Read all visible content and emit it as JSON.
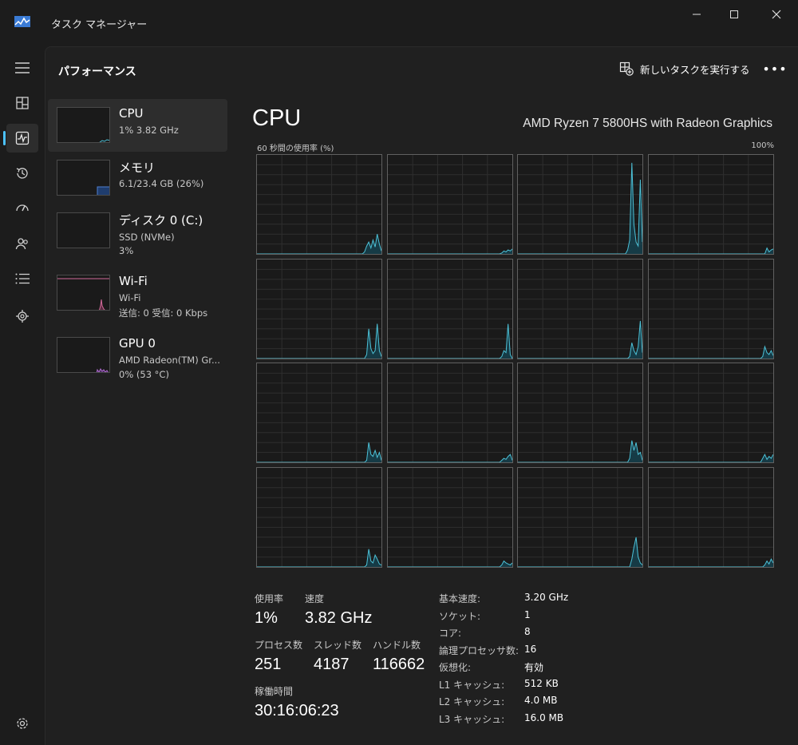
{
  "window": {
    "title": "タスク マネージャー"
  },
  "header": {
    "page_title": "パフォーマンス",
    "new_task_label": "新しいタスクを実行する",
    "more_label": "•••"
  },
  "nav": {
    "items": [
      {
        "name": "hamburger-icon"
      },
      {
        "name": "processes-icon"
      },
      {
        "name": "performance-icon",
        "active": true
      },
      {
        "name": "app-history-icon"
      },
      {
        "name": "startup-icon"
      },
      {
        "name": "users-icon"
      },
      {
        "name": "details-icon"
      },
      {
        "name": "services-icon"
      }
    ],
    "settings": "gear-icon"
  },
  "sidebar": {
    "items": [
      {
        "name": "CPU",
        "sub1": "1% 3.82 GHz",
        "sub2": "",
        "sub3": "",
        "color": "#4cc2d8"
      },
      {
        "name": "メモリ",
        "sub1": "6.1/23.4 GB (26%)",
        "sub2": "",
        "sub3": "",
        "color": "#4f7fd0",
        "level": 26
      },
      {
        "name": "ディスク 0 (C:)",
        "sub1": "SSD (NVMe)",
        "sub2": "3%",
        "sub3": "",
        "color": "#5fb85f"
      },
      {
        "name": "Wi-Fi",
        "sub1": "Wi-Fi",
        "sub2": "送信: 0 受信: 0 Kbps",
        "sub3": "",
        "color": "#d36a9a"
      },
      {
        "name": "GPU 0",
        "sub1": "AMD Radeon(TM) Gr...",
        "sub2": "0% (53 °C)",
        "sub3": "",
        "color": "#b06cd0"
      }
    ]
  },
  "main": {
    "title": "CPU",
    "model": "AMD Ryzen 7 5800HS with Radeon Graphics",
    "graph_label": "60 秒間の使用率 (%)",
    "graph_max": "100%",
    "line_color": "#4cc2d8"
  },
  "chart_data": {
    "type": "area",
    "title": "",
    "x_range": [
      0,
      60
    ],
    "ylim": [
      0,
      100
    ],
    "series": [
      {
        "values": [
          0,
          0,
          0,
          0,
          0,
          0,
          0,
          0,
          0,
          0,
          0,
          0,
          0,
          0,
          0,
          0,
          0,
          0,
          0,
          0,
          0,
          0,
          0,
          0,
          0,
          0,
          0,
          0,
          0,
          0,
          0,
          0,
          0,
          0,
          0,
          0,
          0,
          0,
          0,
          0,
          0,
          0,
          0,
          0,
          0,
          0,
          0,
          0,
          0,
          0,
          0,
          2,
          8,
          12,
          6,
          14,
          7,
          20,
          10,
          3
        ]
      },
      {
        "values": [
          0,
          0,
          0,
          0,
          0,
          0,
          0,
          0,
          0,
          0,
          0,
          0,
          0,
          0,
          0,
          0,
          0,
          0,
          0,
          0,
          0,
          0,
          0,
          0,
          0,
          0,
          0,
          0,
          0,
          0,
          0,
          0,
          0,
          0,
          0,
          0,
          0,
          0,
          0,
          0,
          0,
          0,
          0,
          0,
          0,
          0,
          0,
          0,
          0,
          0,
          0,
          0,
          0,
          0,
          1,
          3,
          2,
          4,
          3,
          5
        ]
      },
      {
        "values": [
          0,
          0,
          0,
          0,
          0,
          0,
          0,
          0,
          0,
          0,
          0,
          0,
          0,
          0,
          0,
          0,
          0,
          0,
          0,
          0,
          0,
          0,
          0,
          0,
          0,
          0,
          0,
          0,
          0,
          0,
          0,
          0,
          0,
          0,
          0,
          0,
          0,
          0,
          0,
          0,
          0,
          0,
          0,
          0,
          0,
          0,
          0,
          0,
          0,
          0,
          0,
          0,
          4,
          14,
          92,
          30,
          12,
          8,
          75,
          12
        ]
      },
      {
        "values": [
          0,
          0,
          0,
          0,
          0,
          0,
          0,
          0,
          0,
          0,
          0,
          0,
          0,
          0,
          0,
          0,
          0,
          0,
          0,
          0,
          0,
          0,
          0,
          0,
          0,
          0,
          0,
          0,
          0,
          0,
          0,
          0,
          0,
          0,
          0,
          0,
          0,
          0,
          0,
          0,
          0,
          0,
          0,
          0,
          0,
          0,
          0,
          0,
          0,
          0,
          0,
          0,
          0,
          0,
          0,
          0,
          6,
          2,
          4,
          5
        ]
      },
      {
        "values": [
          0,
          0,
          0,
          0,
          0,
          0,
          0,
          0,
          0,
          0,
          0,
          0,
          0,
          0,
          0,
          0,
          0,
          0,
          0,
          0,
          0,
          0,
          0,
          0,
          0,
          0,
          0,
          0,
          0,
          0,
          0,
          0,
          0,
          0,
          0,
          0,
          0,
          0,
          0,
          0,
          0,
          0,
          0,
          0,
          0,
          0,
          0,
          0,
          0,
          0,
          0,
          0,
          4,
          30,
          10,
          5,
          8,
          35,
          8,
          2
        ]
      },
      {
        "values": [
          0,
          0,
          0,
          0,
          0,
          0,
          0,
          0,
          0,
          0,
          0,
          0,
          0,
          0,
          0,
          0,
          0,
          0,
          0,
          0,
          0,
          0,
          0,
          0,
          0,
          0,
          0,
          0,
          0,
          0,
          0,
          0,
          0,
          0,
          0,
          0,
          0,
          0,
          0,
          0,
          0,
          0,
          0,
          0,
          0,
          0,
          0,
          0,
          0,
          0,
          0,
          0,
          0,
          0,
          2,
          8,
          6,
          35,
          4,
          0
        ]
      },
      {
        "values": [
          0,
          0,
          0,
          0,
          0,
          0,
          0,
          0,
          0,
          0,
          0,
          0,
          0,
          0,
          0,
          0,
          0,
          0,
          0,
          0,
          0,
          0,
          0,
          0,
          0,
          0,
          0,
          0,
          0,
          0,
          0,
          0,
          0,
          0,
          0,
          0,
          0,
          0,
          0,
          0,
          0,
          0,
          0,
          0,
          0,
          0,
          0,
          0,
          0,
          0,
          0,
          0,
          0,
          2,
          16,
          8,
          4,
          12,
          38,
          6
        ]
      },
      {
        "values": [
          0,
          0,
          0,
          0,
          0,
          0,
          0,
          0,
          0,
          0,
          0,
          0,
          0,
          0,
          0,
          0,
          0,
          0,
          0,
          0,
          0,
          0,
          0,
          0,
          0,
          0,
          0,
          0,
          0,
          0,
          0,
          0,
          0,
          0,
          0,
          0,
          0,
          0,
          0,
          0,
          0,
          0,
          0,
          0,
          0,
          0,
          0,
          0,
          0,
          0,
          0,
          0,
          0,
          0,
          2,
          12,
          6,
          4,
          8,
          3
        ]
      },
      {
        "values": [
          0,
          0,
          0,
          0,
          0,
          0,
          0,
          0,
          0,
          0,
          0,
          0,
          0,
          0,
          0,
          0,
          0,
          0,
          0,
          0,
          0,
          0,
          0,
          0,
          0,
          0,
          0,
          0,
          0,
          0,
          0,
          0,
          0,
          0,
          0,
          0,
          0,
          0,
          0,
          0,
          0,
          0,
          0,
          0,
          0,
          0,
          0,
          0,
          0,
          0,
          0,
          0,
          2,
          20,
          8,
          6,
          12,
          5,
          10,
          2
        ]
      },
      {
        "values": [
          0,
          0,
          0,
          0,
          0,
          0,
          0,
          0,
          0,
          0,
          0,
          0,
          0,
          0,
          0,
          0,
          0,
          0,
          0,
          0,
          0,
          0,
          0,
          0,
          0,
          0,
          0,
          0,
          0,
          0,
          0,
          0,
          0,
          0,
          0,
          0,
          0,
          0,
          0,
          0,
          0,
          0,
          0,
          0,
          0,
          0,
          0,
          0,
          0,
          0,
          0,
          0,
          0,
          0,
          2,
          4,
          3,
          6,
          8,
          2
        ]
      },
      {
        "values": [
          0,
          0,
          0,
          0,
          0,
          0,
          0,
          0,
          0,
          0,
          0,
          0,
          0,
          0,
          0,
          0,
          0,
          0,
          0,
          0,
          0,
          0,
          0,
          0,
          0,
          0,
          0,
          0,
          0,
          0,
          0,
          0,
          0,
          0,
          0,
          0,
          0,
          0,
          0,
          0,
          0,
          0,
          0,
          0,
          0,
          0,
          0,
          0,
          0,
          0,
          0,
          0,
          0,
          4,
          22,
          12,
          20,
          8,
          10,
          2
        ]
      },
      {
        "values": [
          0,
          0,
          0,
          0,
          0,
          0,
          0,
          0,
          0,
          0,
          0,
          0,
          0,
          0,
          0,
          0,
          0,
          0,
          0,
          0,
          0,
          0,
          0,
          0,
          0,
          0,
          0,
          0,
          0,
          0,
          0,
          0,
          0,
          0,
          0,
          0,
          0,
          0,
          0,
          0,
          0,
          0,
          0,
          0,
          0,
          0,
          0,
          0,
          0,
          0,
          0,
          0,
          0,
          0,
          4,
          8,
          3,
          6,
          4,
          8
        ]
      },
      {
        "values": [
          0,
          0,
          0,
          0,
          0,
          0,
          0,
          0,
          0,
          0,
          0,
          0,
          0,
          0,
          0,
          0,
          0,
          0,
          0,
          0,
          0,
          0,
          0,
          0,
          0,
          0,
          0,
          0,
          0,
          0,
          0,
          0,
          0,
          0,
          0,
          0,
          0,
          0,
          0,
          0,
          0,
          0,
          0,
          0,
          0,
          0,
          0,
          0,
          0,
          0,
          0,
          0,
          2,
          18,
          6,
          4,
          12,
          8,
          3,
          2
        ]
      },
      {
        "values": [
          0,
          0,
          0,
          0,
          0,
          0,
          0,
          0,
          0,
          0,
          0,
          0,
          0,
          0,
          0,
          0,
          0,
          0,
          0,
          0,
          0,
          0,
          0,
          0,
          0,
          0,
          0,
          0,
          0,
          0,
          0,
          0,
          0,
          0,
          0,
          0,
          0,
          0,
          0,
          0,
          0,
          0,
          0,
          0,
          0,
          0,
          0,
          0,
          0,
          0,
          0,
          0,
          0,
          0,
          2,
          6,
          4,
          3,
          2,
          4
        ]
      },
      {
        "values": [
          0,
          0,
          0,
          0,
          0,
          0,
          0,
          0,
          0,
          0,
          0,
          0,
          0,
          0,
          0,
          0,
          0,
          0,
          0,
          0,
          0,
          0,
          0,
          0,
          0,
          0,
          0,
          0,
          0,
          0,
          0,
          0,
          0,
          0,
          0,
          0,
          0,
          0,
          0,
          0,
          0,
          0,
          0,
          0,
          0,
          0,
          0,
          0,
          0,
          0,
          0,
          0,
          0,
          0,
          8,
          20,
          30,
          10,
          4,
          2
        ]
      },
      {
        "values": [
          0,
          0,
          0,
          0,
          0,
          0,
          0,
          0,
          0,
          0,
          0,
          0,
          0,
          0,
          0,
          0,
          0,
          0,
          0,
          0,
          0,
          0,
          0,
          0,
          0,
          0,
          0,
          0,
          0,
          0,
          0,
          0,
          0,
          0,
          0,
          0,
          0,
          0,
          0,
          0,
          0,
          0,
          0,
          0,
          0,
          0,
          0,
          0,
          0,
          0,
          0,
          0,
          0,
          0,
          0,
          2,
          6,
          3,
          8,
          4
        ]
      }
    ],
    "grid": true
  },
  "stats": {
    "usage_label": "使用率",
    "usage_value": "1%",
    "speed_label": "速度",
    "speed_value": "3.82 GHz",
    "proc_label": "プロセス数",
    "proc_value": "251",
    "thread_label": "スレッド数",
    "thread_value": "4187",
    "handle_label": "ハンドル数",
    "handle_value": "116662",
    "uptime_label": "稼働時間",
    "uptime_value": "30:16:06:23"
  },
  "specs": [
    {
      "label": "基本速度:",
      "value": "3.20 GHz"
    },
    {
      "label": "ソケット:",
      "value": "1"
    },
    {
      "label": "コア:",
      "value": "8"
    },
    {
      "label": "論理プロセッサ数:",
      "value": "16"
    },
    {
      "label": "仮想化:",
      "value": "有効"
    },
    {
      "label": "L1 キャッシュ:",
      "value": "512 KB"
    },
    {
      "label": "L2 キャッシュ:",
      "value": "4.0 MB"
    },
    {
      "label": "L3 キャッシュ:",
      "value": "16.0 MB"
    }
  ]
}
